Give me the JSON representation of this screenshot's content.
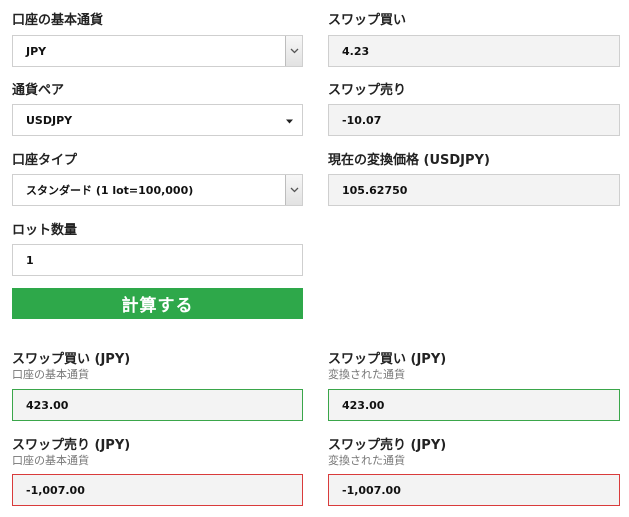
{
  "left": {
    "base_currency_label": "口座の基本通貨",
    "base_currency_value": "JPY",
    "pair_label": "通貨ペア",
    "pair_value": "USDJPY",
    "account_type_label": "口座タイプ",
    "account_type_value": "スタンダード (1 lot=100,000)",
    "lot_label": "ロット数量",
    "lot_value": "1",
    "calculate_button": "計算する"
  },
  "right": {
    "swap_buy_label": "スワップ買い",
    "swap_buy_value": "4.23",
    "swap_sell_label": "スワップ売り",
    "swap_sell_value": "-10.07",
    "rate_label": "現在の変換価格 (USDJPY)",
    "rate_value": "105.62750"
  },
  "results": {
    "buy_base_title": "スワップ買い (JPY)",
    "buy_base_sub": "口座の基本通貨",
    "buy_base_value": "423.00",
    "buy_conv_title": "スワップ買い (JPY)",
    "buy_conv_sub": "変換された通貨",
    "buy_conv_value": "423.00",
    "sell_base_title": "スワップ売り (JPY)",
    "sell_base_sub": "口座の基本通貨",
    "sell_base_value": "-1,007.00",
    "sell_conv_title": "スワップ売り (JPY)",
    "sell_conv_sub": "変換された通貨",
    "sell_conv_value": "-1,007.00"
  },
  "colors": {
    "button_green": "#2ea84a",
    "positive_border": "#3aa64a",
    "negative_border": "#d93b3b"
  }
}
